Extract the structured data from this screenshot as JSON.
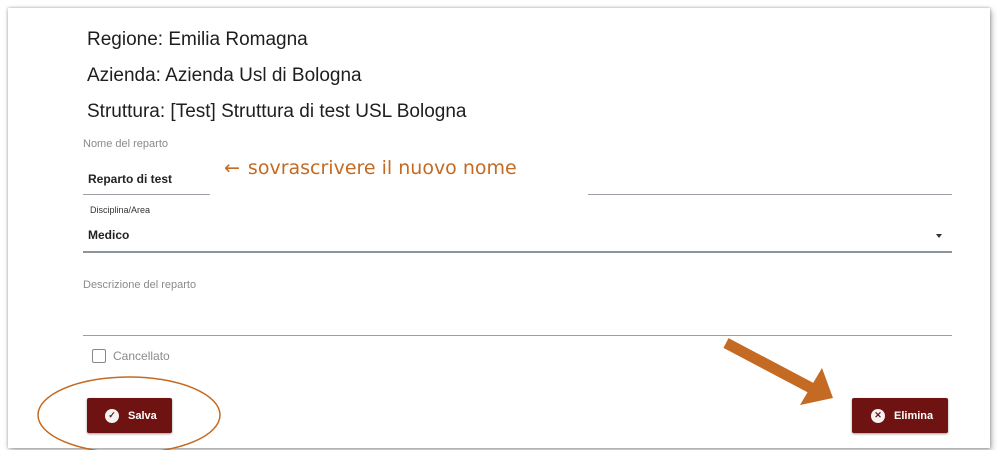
{
  "header": {
    "regione": "Regione: Emilia Romagna",
    "azienda": "Azienda: Azienda Usl di Bologna",
    "struttura": "Struttura: [Test] Struttura di test USL Bologna"
  },
  "form": {
    "nome_label": "Nome del reparto",
    "nome_value": "Reparto di test",
    "disciplina_label": "Disciplina/Area",
    "disciplina_value": "Medico",
    "descrizione_label": "Descrizione del reparto",
    "cancellato_label": "Cancellato"
  },
  "annotation": {
    "arrow": "←",
    "text": "sovrascrivere il nuovo nome"
  },
  "buttons": {
    "salva_label": "Salva",
    "elimina_label": "Elimina"
  },
  "colors": {
    "button_bg": "#6e1212",
    "annotation": "#c46a22",
    "highlight_arrow": "#c46a22"
  },
  "icons": {
    "salva": "check-circle-icon",
    "elimina": "close-circle-icon",
    "dropdown": "caret-down-icon"
  }
}
